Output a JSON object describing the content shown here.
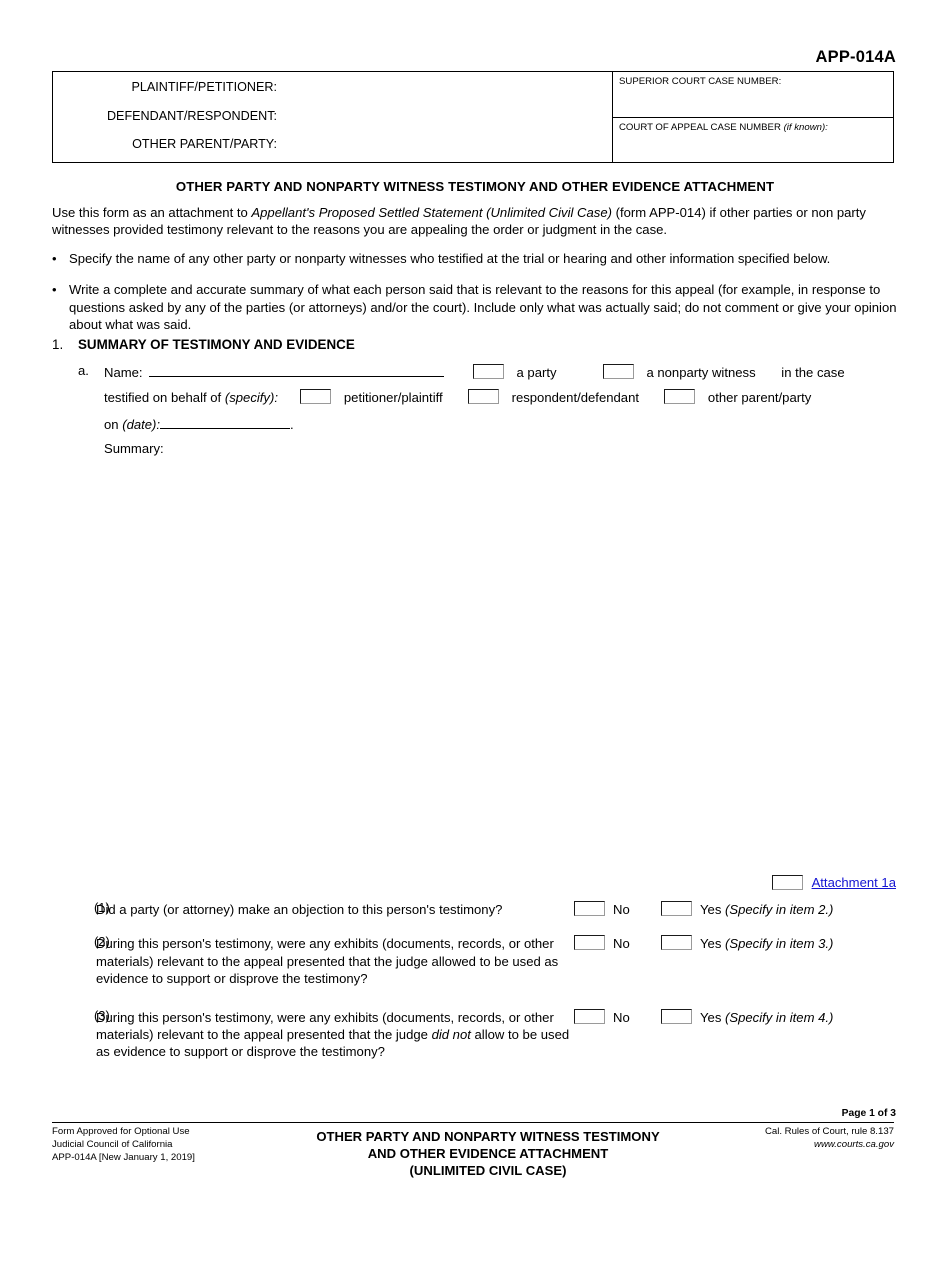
{
  "form_number": "APP-014A",
  "caption": {
    "parties": [
      "PLAINTIFF/PETITIONER:",
      "DEFENDANT/RESPONDENT:",
      "OTHER PARENT/PARTY:"
    ],
    "superior_court_label": "SUPERIOR COURT CASE NUMBER:",
    "court_of_appeal_label": "COURT OF APPEAL CASE NUMBER ",
    "court_of_appeal_italic": "(if known):"
  },
  "doc_title": "OTHER PARTY AND NONPARTY WITNESS TESTIMONY AND OTHER EVIDENCE ATTACHMENT",
  "intro": {
    "part1": "Use this form as an attachment to ",
    "italic1": "Appellant's Proposed Settled Statement (Unlimited Civil Case)",
    "part2": " (form APP-014) if other parties or non party witnesses provided testimony relevant to the reasons you are appealing the order or judgment in the case."
  },
  "bullets": [
    "Specify the name of any other party or nonparty witnesses who testified at the trial or hearing and other information specified below.",
    "Write a complete and accurate summary of what each person said that is relevant to the reasons for this appeal (for example, in response to questions asked by any of the parties (or attorneys) and/or the court). Include only what was actually said; do not comment or give your opinion about what was said."
  ],
  "section1": {
    "number": "1.",
    "heading": "SUMMARY OF TESTIMONY AND EVIDENCE",
    "item_letter": "a.",
    "name_label": "Name:",
    "name_value": "",
    "option_party": "a party",
    "option_nonparty": "a nonparty witness",
    "in_the_case": "in the case",
    "testified_label": "testified on behalf of ",
    "testified_italic": "(specify):",
    "option_petitioner": "petitioner/plaintiff",
    "option_respondent": "respondent/defendant",
    "option_other_parent": "other parent/party",
    "on_label": "on ",
    "on_italic": "(date):",
    "date_value": "",
    "period": ".",
    "summary_label": "Summary:",
    "summary_value": ""
  },
  "attachment": {
    "label": "Attachment 1a"
  },
  "questions": [
    {
      "number": "(1)",
      "text": "Did a party (or attorney) make an objection to this person's testimony?",
      "no_label": "No",
      "yes_label": "Yes ",
      "yes_italic": "(Specify in item 2.)"
    },
    {
      "number": "(2)",
      "text": "During this person's testimony, were any exhibits (documents, records, or other materials) relevant to the appeal presented that the judge allowed to be used as evidence to support or disprove the testimony?",
      "no_label": "No",
      "yes_label": "Yes ",
      "yes_italic": "(Specify in item 3.)"
    },
    {
      "number": "(3)",
      "text_part1": "During this person's testimony, were any exhibits (documents, records, or other materials) relevant to the appeal presented that the judge ",
      "text_italic1": "did not",
      "text_part2": " allow to be used as evidence to support or disprove the testimony?",
      "no_label": "No",
      "yes_label": "Yes ",
      "yes_italic": "(Specify in item 4.)"
    }
  ],
  "footer": {
    "page_number": "Page 1 of 3",
    "left_line1": "Form Approved for Optional Use",
    "left_line2": "Judicial Council of California",
    "left_line3": "APP-014A [New January 1, 2019]",
    "center_line1": "OTHER PARTY AND  NONPARTY WITNESS TESTIMONY",
    "center_line2": "AND OTHER EVIDENCE ATTACHMENT",
    "center_line3": "(UNLIMITED CIVIL CASE)",
    "right_line1": "Cal. Rules of Court, rule 8.137",
    "right_line2": "www.courts.ca.gov"
  }
}
